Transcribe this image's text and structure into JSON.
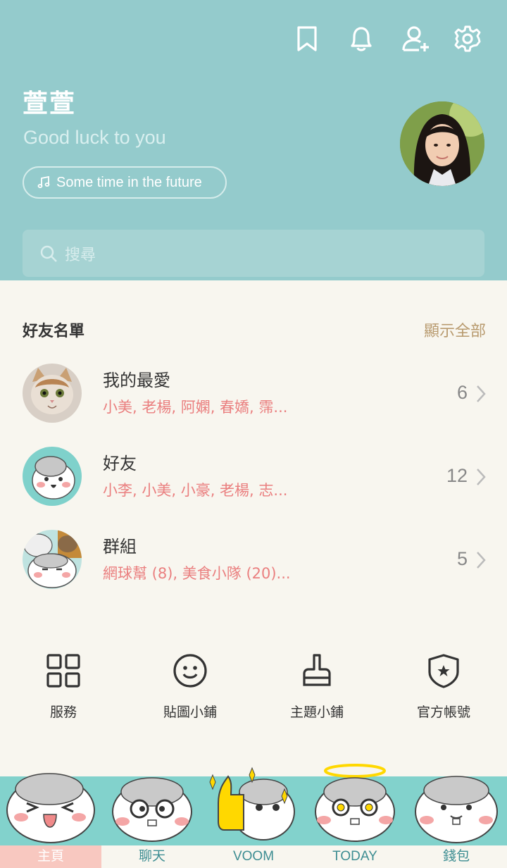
{
  "header": {
    "icons": [
      "bookmark-icon",
      "bell-icon",
      "add-friend-icon",
      "settings-icon"
    ],
    "name": "萱萱",
    "status": "Good luck to you",
    "music": "Some time in the future",
    "search_placeholder": "搜尋"
  },
  "friends": {
    "title": "好友名單",
    "show_all": "顯示全部",
    "items": [
      {
        "title": "我的最愛",
        "sub": "小美, 老楊, 阿嫻, 春嬌, 霈...",
        "count": "6"
      },
      {
        "title": "好友",
        "sub": "小李, 小美, 小豪, 老楊, 志...",
        "count": "12"
      },
      {
        "title": "群組",
        "sub": "網球幫 (8), 美食小隊 (20)...",
        "count": "5"
      }
    ]
  },
  "services": [
    {
      "label": "服務",
      "icon": "grid-icon"
    },
    {
      "label": "貼圖小鋪",
      "icon": "smiley-icon"
    },
    {
      "label": "主題小鋪",
      "icon": "brush-icon"
    },
    {
      "label": "官方帳號",
      "icon": "shield-star-icon"
    }
  ],
  "tabs": [
    {
      "label": "主頁",
      "active": true
    },
    {
      "label": "聊天",
      "active": false
    },
    {
      "label": "VOOM",
      "active": false
    },
    {
      "label": "TODAY",
      "active": false
    },
    {
      "label": "錢包",
      "active": false
    }
  ],
  "colors": {
    "header": "#94cbcc",
    "accent_text": "#ea7f7f",
    "tab_band": "#82d2cc",
    "show_all": "#b89a6e"
  }
}
